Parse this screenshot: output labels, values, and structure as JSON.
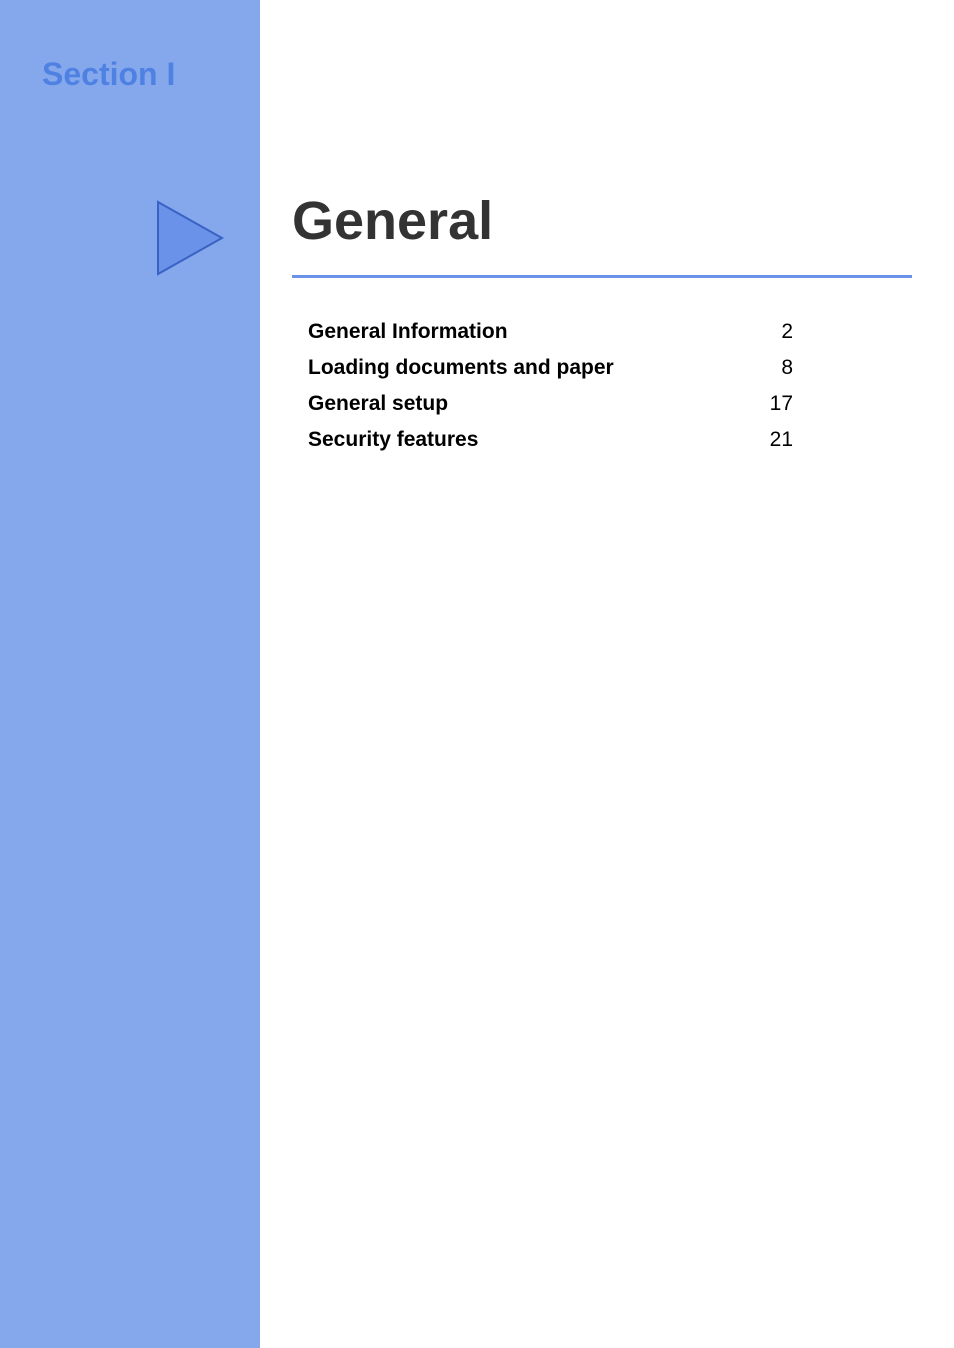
{
  "section_label": "Section I",
  "section_title": "General",
  "toc": [
    {
      "label": "General Information",
      "page": "2"
    },
    {
      "label": "Loading documents and paper",
      "page": "8"
    },
    {
      "label": "General setup",
      "page": "17"
    },
    {
      "label": "Security features",
      "page": "21"
    }
  ]
}
